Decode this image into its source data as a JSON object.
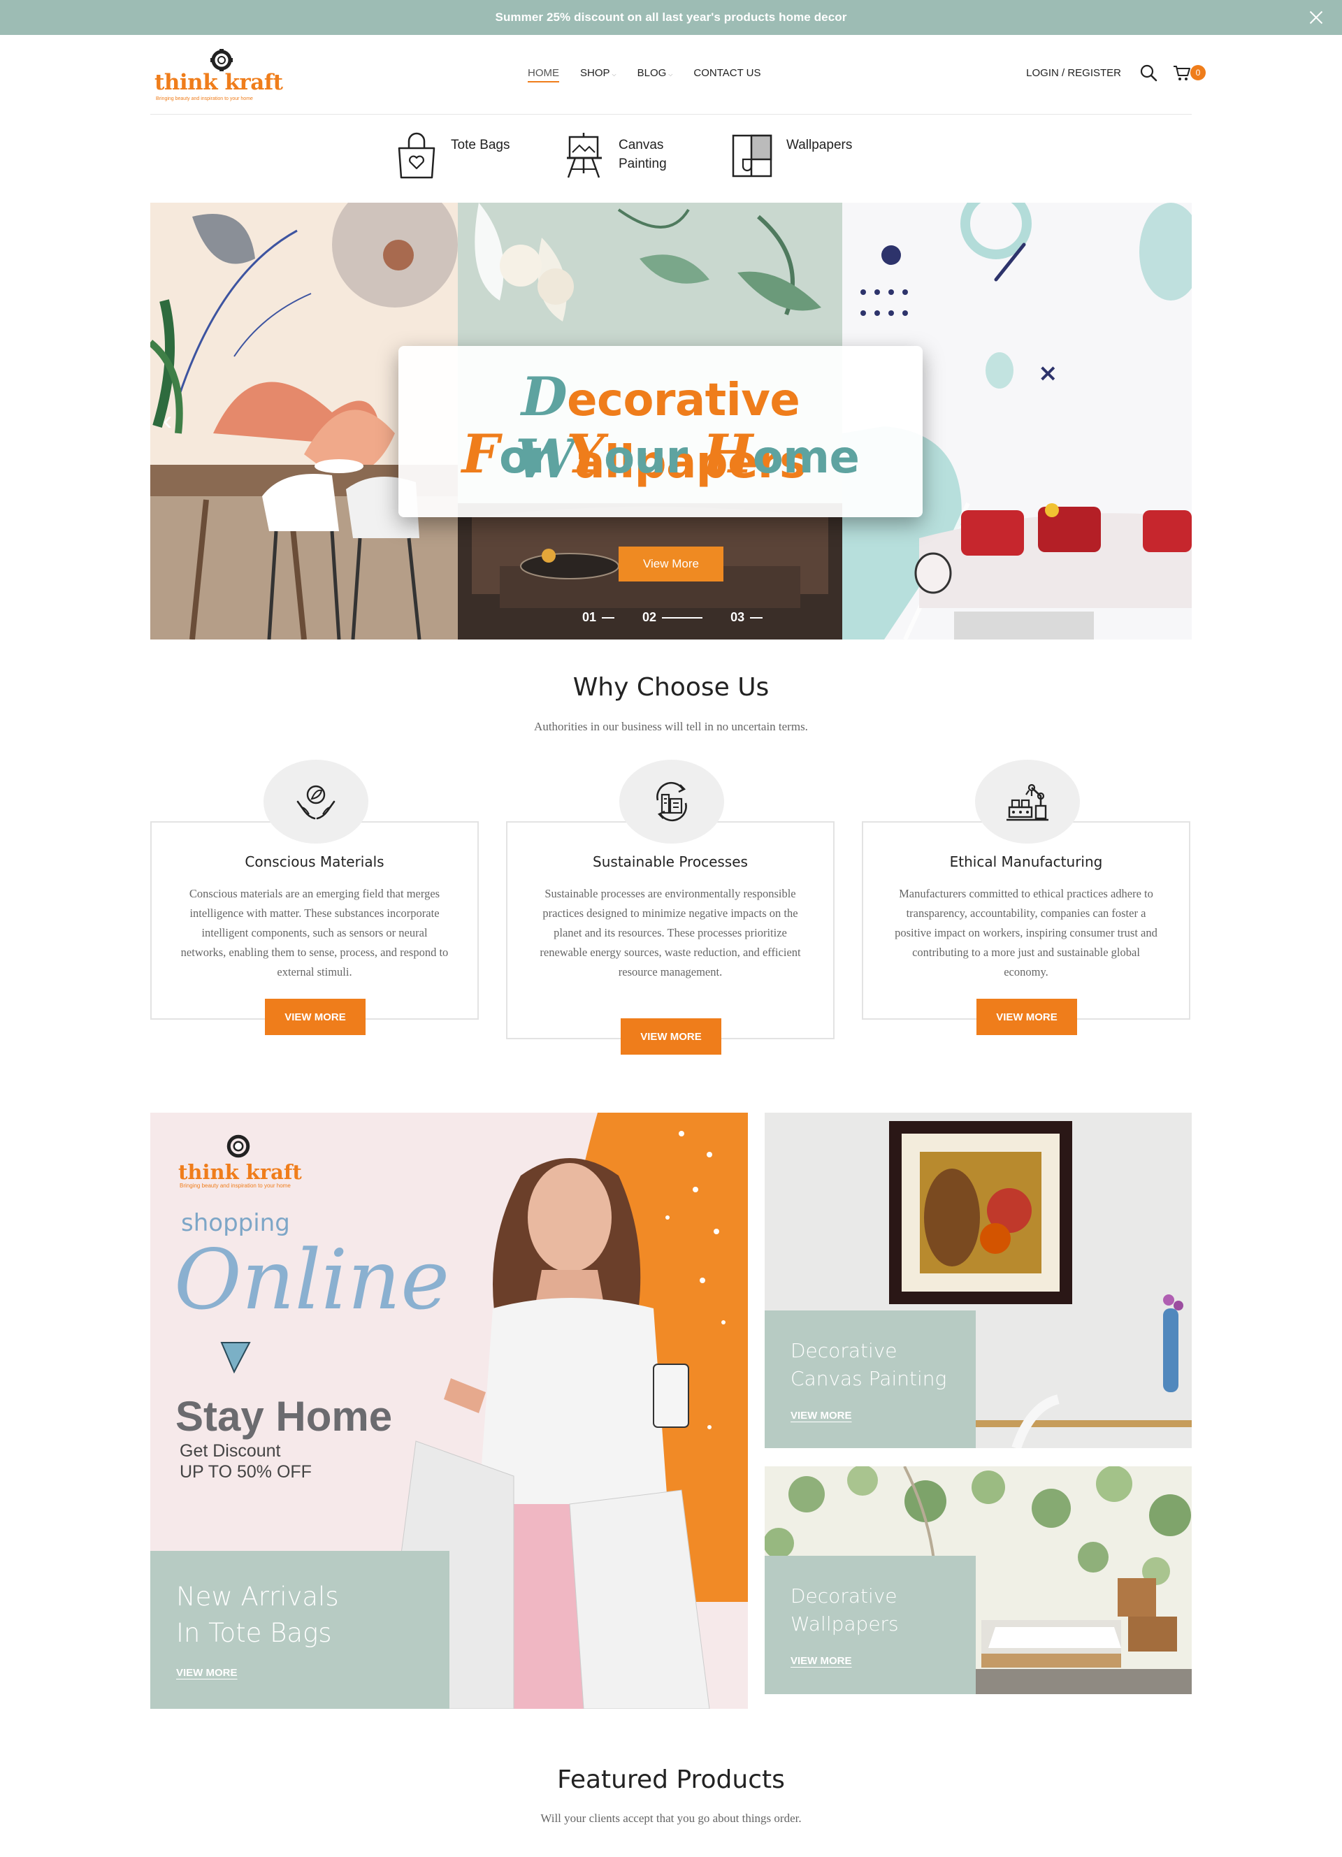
{
  "announcement": {
    "text": "Summer 25% discount on all last year's products home decor"
  },
  "brand": {
    "name": "think kraft",
    "tagline": "Bringing beauty and inspiration to your home",
    "accent": "#ef7d1b",
    "teal": "#9dbcb4"
  },
  "nav": {
    "items": [
      {
        "label": "HOME",
        "active": true
      },
      {
        "label": "SHOP",
        "dropdown": true
      },
      {
        "label": "BLOG",
        "dropdown": true
      },
      {
        "label": "CONTACT US"
      }
    ],
    "login_label": "LOGIN / REGISTER",
    "cart_count": "0"
  },
  "categories": [
    {
      "label": "Tote Bags",
      "icon": "tote-bag-icon"
    },
    {
      "label": "Canvas Painting",
      "icon": "easel-icon"
    },
    {
      "label": "Wallpapers",
      "icon": "wallpaper-icon"
    }
  ],
  "hero": {
    "line1_cap1": "D",
    "line1_rest1": "ecorative ",
    "line1_cap2": "W",
    "line1_rest2": "allpapers",
    "line2_cap1": "F",
    "line2_rest1": "or ",
    "line2_cap2": "Y",
    "line2_rest2": "our ",
    "line2_cap3": "H",
    "line2_rest3": "ome",
    "button": "View More",
    "slides": [
      "01",
      "02",
      "03"
    ],
    "active_slide": 2
  },
  "why": {
    "title": "Why Choose Us",
    "subtitle": "Authorities in our business will tell in no uncertain terms.",
    "features": [
      {
        "title": "Conscious Materials",
        "text": "Conscious materials are an emerging field that merges intelligence with matter. These substances incorporate intelligent components, such as sensors or neural networks, enabling them to sense, process, and respond to external stimuli.",
        "button": "VIEW MORE",
        "icon": "hands-leaf-icon"
      },
      {
        "title": "Sustainable Processes",
        "text": "Sustainable processes are environmentally responsible practices designed to minimize negative impacts on the planet and its resources. These processes prioritize renewable energy sources, waste reduction, and efficient resource management.",
        "button": "VIEW MORE",
        "icon": "recycle-factory-icon"
      },
      {
        "title": "Ethical Manufacturing",
        "text": "Manufacturers committed to ethical practices adhere to transparency, accountability, companies can foster a positive impact on workers,  inspiring consumer trust and contributing to a more just and sustainable global economy.",
        "button": "VIEW MORE",
        "icon": "robot-arm-icon"
      }
    ]
  },
  "promo": {
    "brand_name": "think kraft",
    "brand_tagline": "Bringing beauty and inspiration to your home",
    "shopping": "shopping",
    "online": "Online",
    "stay_home": "Stay Home",
    "discount_line1": "Get Discount",
    "discount_line2": "UP TO 50% OFF"
  },
  "banners": [
    {
      "line1": "New Arrivals",
      "line2": "In Tote Bags",
      "link": "VIEW MORE"
    },
    {
      "line1": "Decorative",
      "line2": "Canvas Painting",
      "link": "VIEW MORE"
    },
    {
      "line1": "Decorative",
      "line2": "Wallpapers",
      "link": "VIEW MORE"
    }
  ],
  "featured": {
    "title": "Featured Products",
    "subtitle": "Will your clients accept that you go about things order."
  }
}
